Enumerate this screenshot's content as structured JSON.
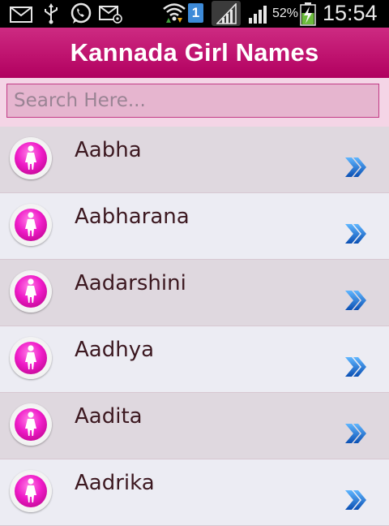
{
  "status_bar": {
    "sim_slot": "1",
    "battery_percent": "52%",
    "time": "15:54",
    "icons": [
      "email-icon",
      "usb-icon",
      "whatsapp-icon",
      "email-icon",
      "wifi-icon",
      "sim-badge",
      "signal-icon",
      "signal-icon",
      "charging-battery-icon"
    ]
  },
  "header": {
    "title": "Kannada Girl Names",
    "color": "#c0166f"
  },
  "search": {
    "placeholder": "Search Here...",
    "value": ""
  },
  "list": {
    "items": [
      {
        "name": "Aabha"
      },
      {
        "name": "Aabharana"
      },
      {
        "name": "Aadarshini"
      },
      {
        "name": "Aadhya"
      },
      {
        "name": "Aadita"
      },
      {
        "name": "Aadrika"
      }
    ],
    "item_icon": "female-avatar-icon",
    "row_action_icon": "chevron-right-double-icon"
  }
}
